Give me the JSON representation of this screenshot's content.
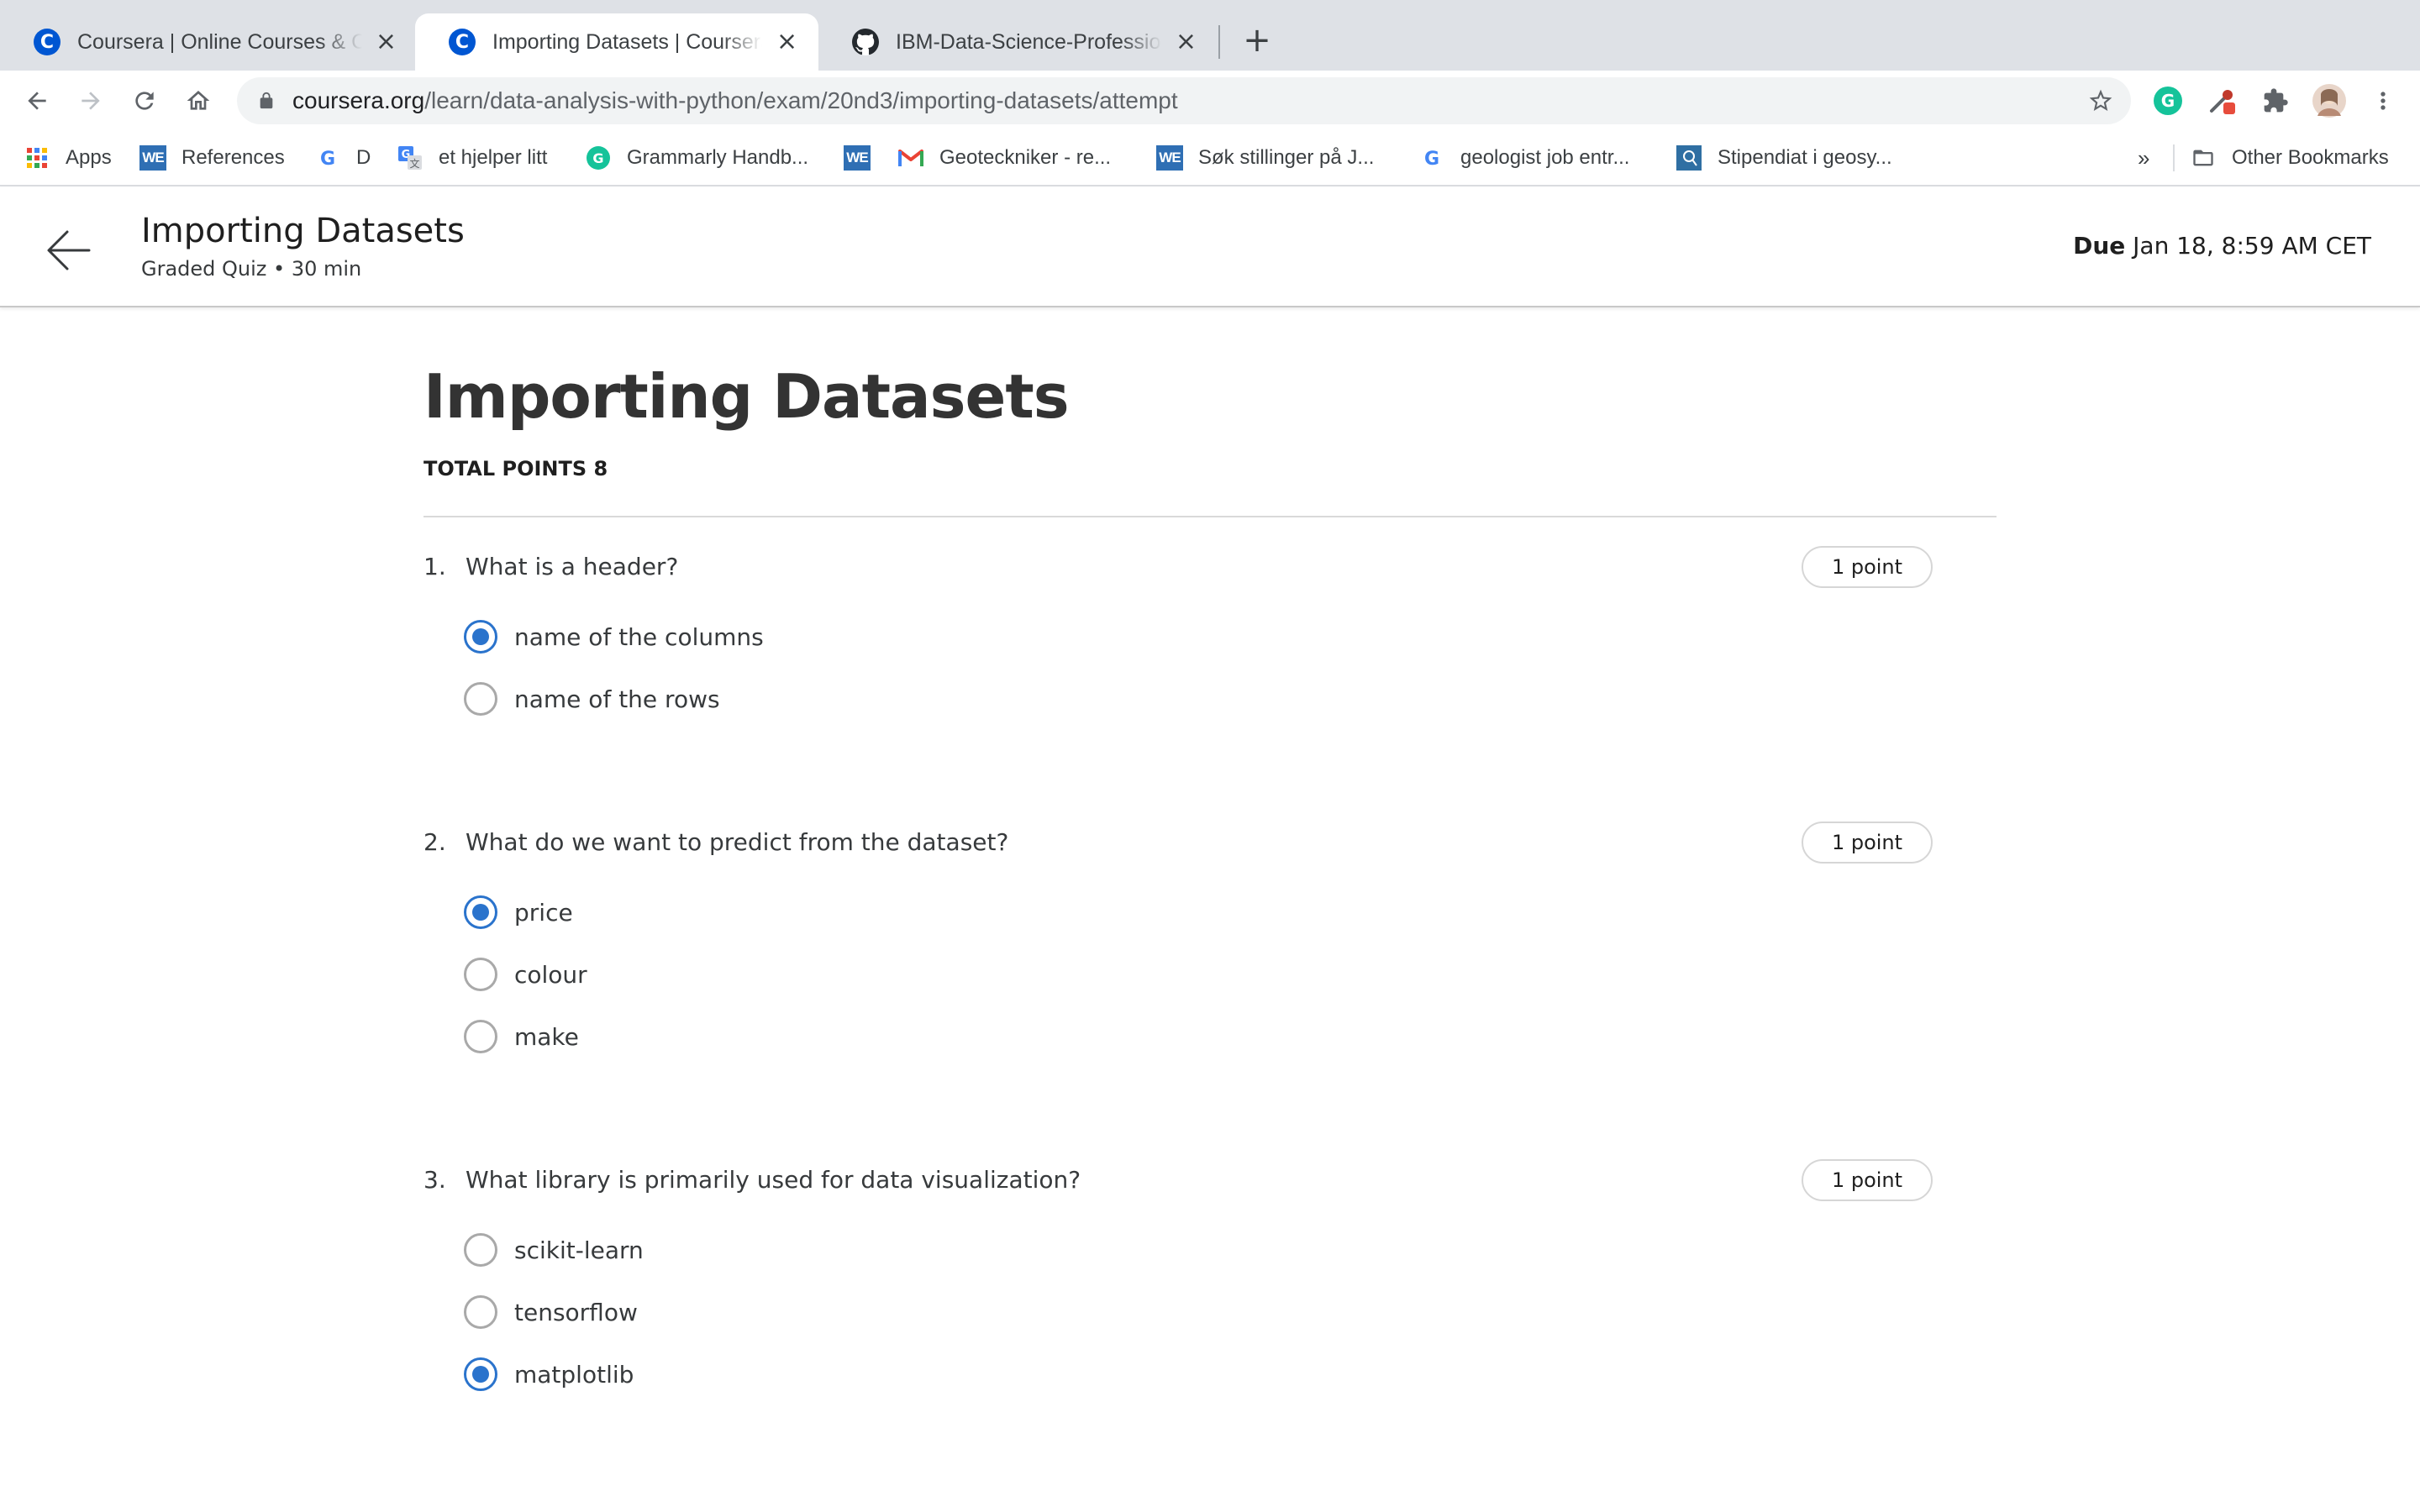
{
  "browser": {
    "tabs": [
      {
        "title": "Coursera | Online Courses & Credentials",
        "icon": "coursera-icon",
        "active": false
      },
      {
        "title": "Importing Datasets | Coursera",
        "icon": "coursera-icon",
        "active": true
      },
      {
        "title": "IBM-Data-Science-Professional-Certificate",
        "icon": "github-icon",
        "active": false
      }
    ],
    "url_host": "coursera.org",
    "url_path": "/learn/data-analysis-with-python/exam/20nd3/importing-datasets/attempt",
    "bookmarks": [
      {
        "label": "Apps",
        "icon": "apps-grid-icon"
      },
      {
        "label": "References",
        "icon": "we-icon"
      },
      {
        "label": "D",
        "icon": "google-icon"
      },
      {
        "label": "et hjelper litt",
        "icon": "google-translate-icon"
      },
      {
        "label": "Grammarly Handb...",
        "icon": "grammarly-icon"
      },
      {
        "label": "",
        "icon": "we-icon"
      },
      {
        "label": "Geoteckniker - re...",
        "icon": "gmail-icon"
      },
      {
        "label": "Søk stillinger på J...",
        "icon": "we-icon"
      },
      {
        "label": "geologist job entr...",
        "icon": "google-icon"
      },
      {
        "label": "Stipendiat i geosy...",
        "icon": "site-icon"
      }
    ],
    "overflow": "»",
    "other_bookmarks": "Other Bookmarks"
  },
  "header": {
    "title": "Importing Datasets",
    "subtitle": "Graded Quiz • 30 min",
    "due_label": "Due",
    "due_value": "Jan 18, 8:59 AM CET"
  },
  "quiz": {
    "title": "Importing Datasets",
    "total_points": "TOTAL POINTS 8",
    "questions": [
      {
        "number": "1.",
        "text": "What is a header?",
        "points": "1 point",
        "options": [
          {
            "label": "name of the columns",
            "selected": true
          },
          {
            "label": "name of the rows",
            "selected": false
          }
        ]
      },
      {
        "number": "2.",
        "text": "What do we want to predict from the dataset?",
        "points": "1 point",
        "options": [
          {
            "label": "price",
            "selected": true
          },
          {
            "label": "colour",
            "selected": false
          },
          {
            "label": "make",
            "selected": false
          }
        ]
      },
      {
        "number": "3.",
        "text": "What library is primarily used for data visualization?",
        "points": "1 point",
        "options": [
          {
            "label": "scikit-learn",
            "selected": false
          },
          {
            "label": "tensorflow",
            "selected": false
          },
          {
            "label": "matplotlib",
            "selected": true
          }
        ]
      }
    ]
  },
  "colors": {
    "accent": "#2a73cc",
    "coursera_brand": "#0056d2"
  }
}
